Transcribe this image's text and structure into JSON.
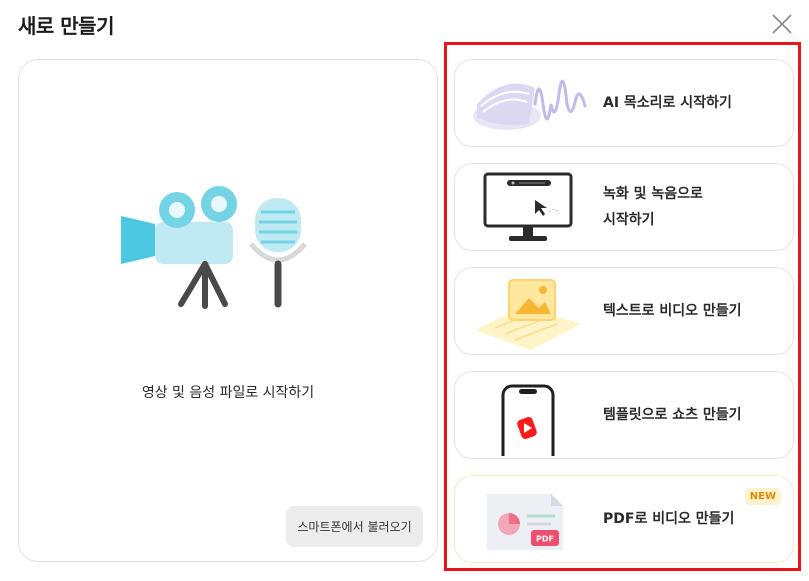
{
  "dialog": {
    "title": "새로 만들기"
  },
  "left": {
    "label": "영상 및 음성 파일로 시작하기",
    "phone_button": "스마트폰에서 불러오기"
  },
  "options": [
    {
      "label_line1": "AI 목소리로 시작하기",
      "label_line2": ""
    },
    {
      "label_line1": "녹화 및 녹음으로",
      "label_line2": "시작하기"
    },
    {
      "label_line1": "텍스트로 비디오 만들기",
      "label_line2": ""
    },
    {
      "label_line1": "템플릿으로 쇼츠 만들기",
      "label_line2": ""
    },
    {
      "label_line1": "PDF로 비디오 만들기",
      "label_line2": "",
      "badge": "NEW",
      "pdf_tag": "PDF"
    }
  ],
  "colors": {
    "highlight": "#e8141c",
    "accent_cyan": "#4cc8e0",
    "new_badge": "#e08a00"
  }
}
